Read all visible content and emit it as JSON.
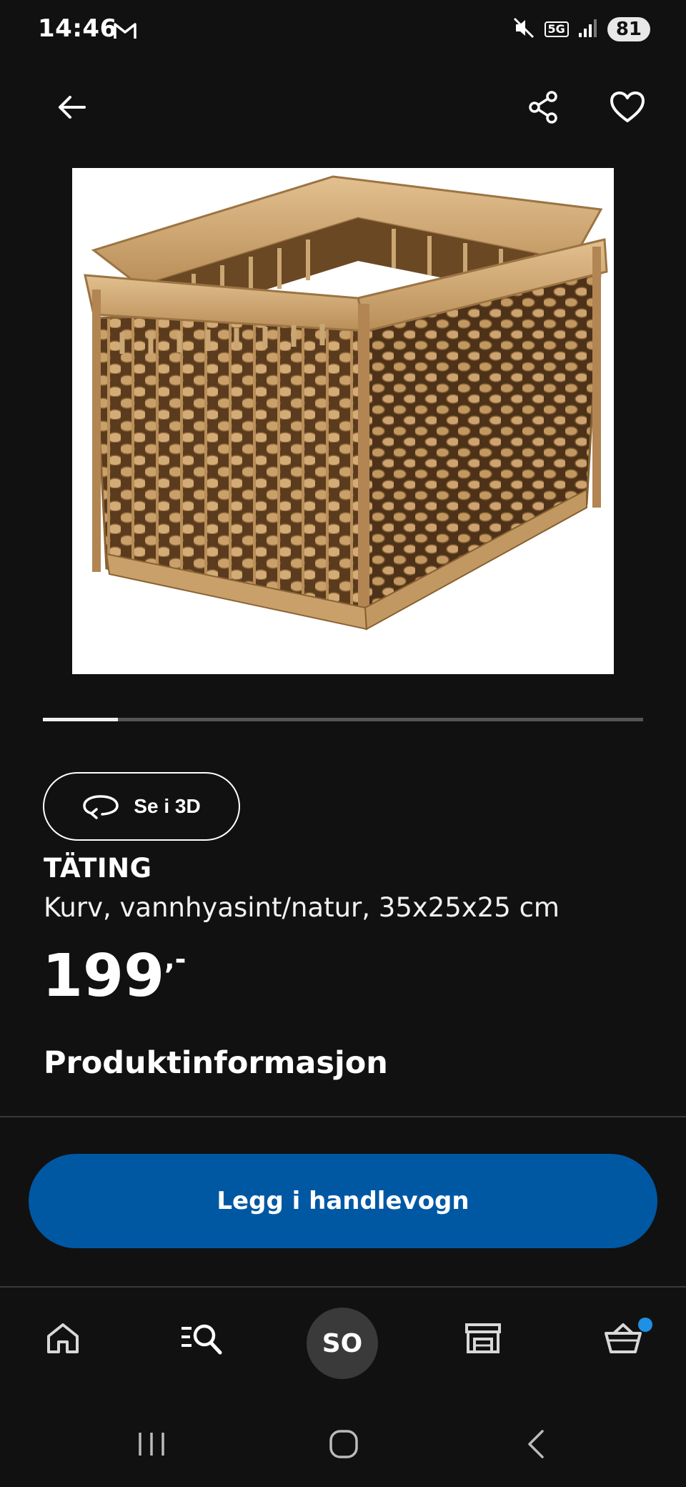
{
  "status_bar": {
    "time": "14:46",
    "battery": "81",
    "network": "5G",
    "icons": [
      "gmail-icon",
      "mute-icon",
      "5g-icon",
      "signal-icon",
      "battery-icon"
    ]
  },
  "top_bar": {
    "icons": [
      "arrow-left-icon",
      "share-icon",
      "heart-icon"
    ]
  },
  "carousel": {
    "position_fraction": 0.125
  },
  "view_3d": {
    "label": "Se i 3D",
    "icon": "rotate-3d-icon"
  },
  "product": {
    "name": "TÄTING",
    "description": "Kurv, vannhyasint/natur, 35x25x25 cm",
    "price": "199",
    "price_suffix": ",-"
  },
  "sections": {
    "product_info": "Produktinformasjon"
  },
  "cart_button": {
    "label": "Legg i handlevogn"
  },
  "bottom_nav": {
    "avatar_initials": "SO",
    "items": [
      "home-icon",
      "search-list-icon",
      "avatar",
      "store-icon",
      "cart-icon"
    ],
    "cart_badge_color": "#1e90e6"
  },
  "colors": {
    "background": "#111111",
    "accent_blue": "#0058a3",
    "divider": "#3a3a3a"
  }
}
